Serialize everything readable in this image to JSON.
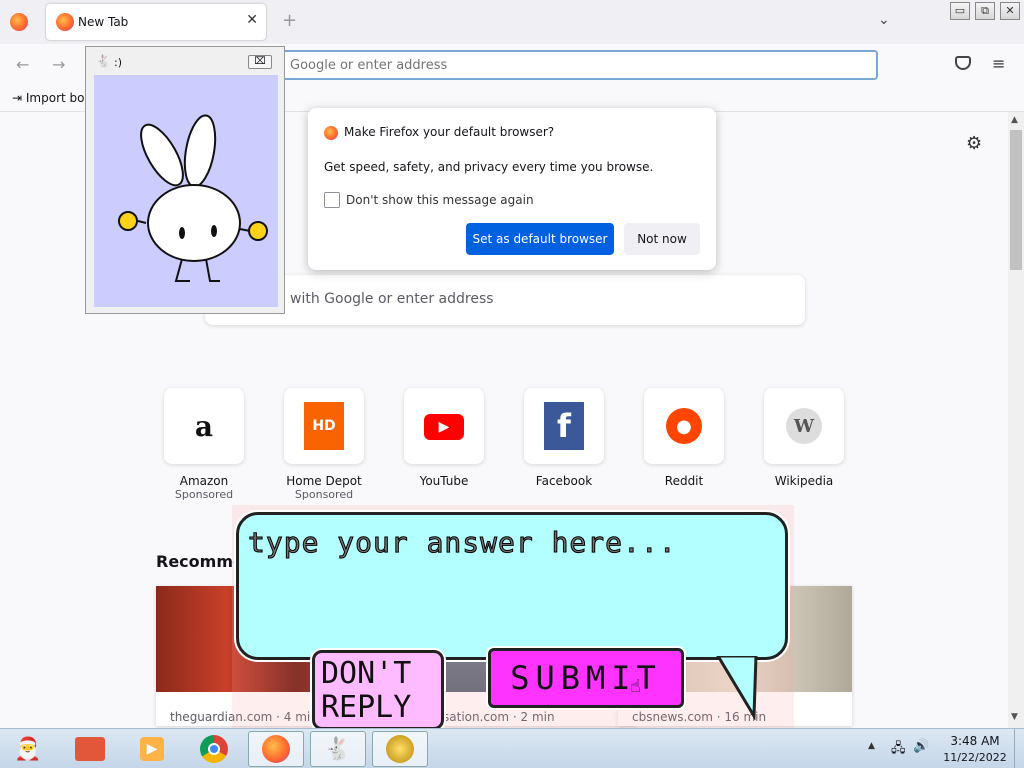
{
  "browser": {
    "tab_title": "New Tab",
    "tab_close": "✕",
    "new_tab": "+",
    "tab_list": "⌄",
    "window_controls": [
      "▭",
      "⧉",
      "✕"
    ],
    "url_placeholder": "Google or enter address",
    "import_bookmarks": "Import bo",
    "menu_icon": "≡"
  },
  "newtab": {
    "search_placeholder": "ch with Google or enter address",
    "recommended_heading": "Recomme",
    "top_sites": [
      {
        "name": "Amazon",
        "sponsored": "Sponsored",
        "icon": "a",
        "color": "#111"
      },
      {
        "name": "Home Depot",
        "sponsored": "Sponsored",
        "icon": "HD",
        "color": "#f96302"
      },
      {
        "name": "YouTube",
        "sponsored": "",
        "icon": "▶",
        "color": "#ff0000"
      },
      {
        "name": "Facebook",
        "sponsored": "",
        "icon": "f",
        "color": "#3b5998"
      },
      {
        "name": "Reddit",
        "sponsored": "",
        "icon": "●",
        "color": "#ff4500"
      },
      {
        "name": "Wikipedia",
        "sponsored": "",
        "icon": "W",
        "color": "#777"
      }
    ],
    "stories": [
      {
        "source": "theguardian.com · 4 min"
      },
      {
        "source": "nversation.com · 2 min"
      },
      {
        "source": "cbsnews.com · 16 min"
      }
    ]
  },
  "dialog": {
    "title": "Make Firefox your default browser?",
    "body": "Get speed, safety, and privacy every time you browse.",
    "checkbox_label": "Don't show this message again",
    "primary_button": "Set as default browser",
    "secondary_button": "Not now"
  },
  "bunny_window": {
    "title": ":)",
    "close": "⌧"
  },
  "bubble": {
    "placeholder": "type your answer here...",
    "dont_reply": "DON'T REPLY",
    "submit": "SUBMIT"
  },
  "taskbar": {
    "apps": [
      "santa",
      "folder",
      "media",
      "chrome",
      "firefox",
      "bunny",
      "app"
    ],
    "time": "3:48 AM",
    "date": "11/22/2022"
  }
}
